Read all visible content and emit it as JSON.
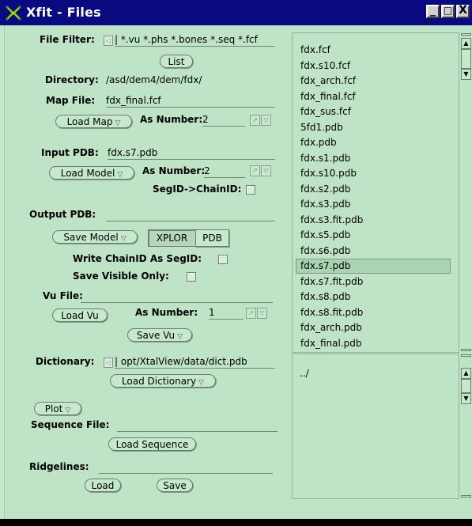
{
  "window": {
    "title": "Xfit - Files",
    "min_glyph": "_",
    "max_glyph": "□",
    "close_glyph": "X"
  },
  "form": {
    "file_filter_label": "File Filter:",
    "file_filter_value": "*.vu *.phs *.bones *.seq *.fcf",
    "list_button": "List",
    "directory_label": "Directory:",
    "directory_value": "/asd/dem4/dem/fdx/",
    "map_file_label": "Map File:",
    "map_file_value": "fdx_final.fcf",
    "load_map_button": "Load Map",
    "map_as_number_label": "As Number:",
    "map_as_number_value": "2",
    "input_pdb_label": "Input PDB:",
    "input_pdb_value": "fdx.s7.pdb",
    "load_model_button": "Load Model",
    "model_as_number_label": "As Number:",
    "model_as_number_value": "2",
    "segid_chainid_label": "SegID->ChainID:",
    "output_pdb_label": "Output PDB:",
    "output_pdb_value": "",
    "save_model_button": "Save Model",
    "xplor_option": "XPLOR",
    "pdb_option": "PDB",
    "write_chainid_label": "Write ChainID As SegID:",
    "save_visible_label": "Save Visible Only:",
    "vu_file_label": "Vu File:",
    "vu_file_value": "",
    "load_vu_button": "Load Vu",
    "vu_as_number_label": "As Number:",
    "vu_as_number_value": "1",
    "save_vu_button": "Save Vu",
    "dictionary_label": "Dictionary:",
    "dictionary_value": "opt/XtalView/data/dict.pdb",
    "load_dictionary_button": "Load Dictionary",
    "plot_button": "Plot",
    "sequence_file_label": "Sequence File:",
    "sequence_file_value": "",
    "load_sequence_button": "Load Sequence",
    "ridgelines_label": "Ridgelines:",
    "ridgelines_value": "",
    "load_button": "Load",
    "save_button": "Save"
  },
  "files": [
    "fdx.fcf",
    "fdx.s10.fcf",
    "fdx_arch.fcf",
    "fdx_final.fcf",
    "fdx_sus.fcf",
    "5fd1.pdb",
    "fdx.pdb",
    "fdx.s1.pdb",
    "fdx.s10.pdb",
    "fdx.s2.pdb",
    "fdx.s3.pdb",
    "fdx.s3.fit.pdb",
    "fdx.s5.pdb",
    "fdx.s6.pdb",
    "fdx.s7.pdb",
    "fdx.s7.fit.pdb",
    "fdx.s8.pdb",
    "fdx.s8.fit.pdb",
    "fdx_arch.pdb",
    "fdx_final.pdb"
  ],
  "selected_file": "fdx.s7.pdb",
  "directories": [
    "../"
  ],
  "icons": {
    "menu_arrow": "▽",
    "up_arrow": "▲",
    "down_arrow": "▼",
    "cycle": "◁"
  },
  "colors": {
    "titlebar": "#0a0a80",
    "panel": "#bfe3c7",
    "selection": "#aad3b3"
  }
}
